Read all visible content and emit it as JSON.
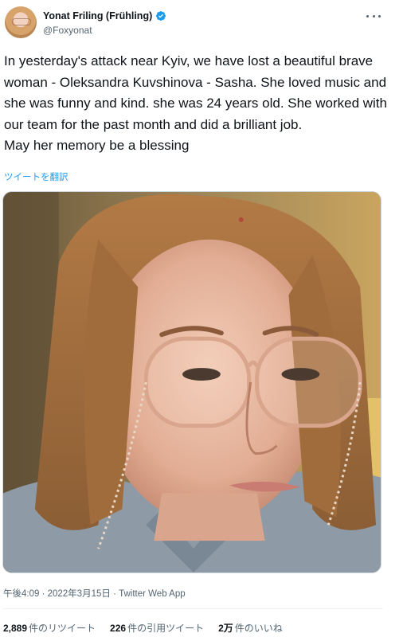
{
  "author": {
    "display_name": "Yonat Friling (Frühling)",
    "handle": "@Foxyonat",
    "avatar_icon": "profile-photo",
    "verified_icon": "verified-badge-icon"
  },
  "tweet": {
    "text": "In yesterday's attack near Kyiv, we have lost a beautiful brave woman -  Oleksandra Kuvshinova - Sasha. She loved music and she was funny and kind. she was 24 years old. She worked with our team for the past month and did a brilliant job.\nMay her memory be a blessing",
    "translate_label": "ツイートを翻訳",
    "meta": "午後4:09 · 2022年3月15日 · Twitter Web App"
  },
  "stats": {
    "retweets_count": "2,889",
    "retweets_label": "件のリツイート",
    "quotes_count": "226",
    "quotes_label": "件の引用ツイート",
    "likes_count": "2万",
    "likes_label": "件のいいね"
  },
  "colors": {
    "link": "#1d9bf0",
    "secondary_text": "#536471",
    "primary_text": "#0f1419"
  }
}
